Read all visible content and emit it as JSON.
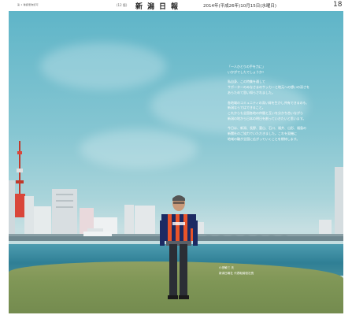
{
  "header": {
    "left_text": "第 1 種郵便物認可",
    "edition_small": "(12 版)",
    "newspaper_name": "新潟日報",
    "date": "2014年(平成26年)10月15日(水曜日)",
    "page_number": "18"
  },
  "message": {
    "paragraphs": [
      [
        "「一人ひとりの手を力に」",
        "いかがでしたでしょうか?"
      ],
      [
        "私自身、この特集を通して",
        "サポーターのみなさまのサッカーと地元への想いの深さを",
        "あらためて思い知らされました。"
      ],
      [
        "各地域のコミュニティの深い絆を生かし共有できるのも、",
        "新潟ならではできること。",
        "これからも全国各地の仲間と互いを分かち合いながら",
        "新潟の地から日本の明日を創っていきたいと思います。"
      ],
      [
        "今日は、新潟、長野、富山、石川、福井、山形、福島の",
        "新聞社のご協力でいただきました。これを契機に",
        "地域の輪が全国に広がっていくことを期待します。"
      ]
    ],
    "signature_name": "小田敏三 氏",
    "signature_title": "新潟日報社 代表取締役社長"
  },
  "colors": {
    "sky_top": "#5fb5c8",
    "grass": "#7f9656",
    "river": "#2f7f95",
    "jersey_orange": "#e8542a",
    "jersey_navy": "#1c2a63"
  }
}
